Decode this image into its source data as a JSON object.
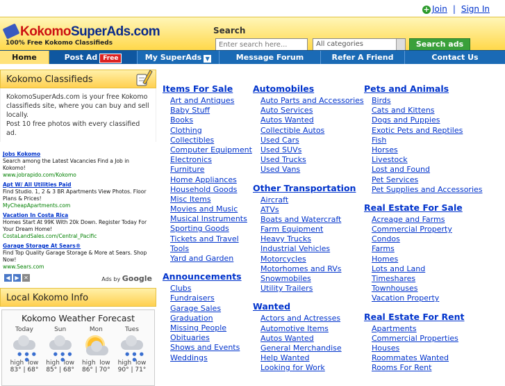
{
  "topbar": {
    "join": "Join",
    "sep": "|",
    "signin": "Sign In"
  },
  "header": {
    "logo_a": "Kokomo",
    "logo_b": "SuperAds",
    "logo_c": ".com",
    "tagline": "100% Free Kokomo Classifieds",
    "search_label": "Search",
    "search_placeholder": "Enter search here...",
    "category_value": "All categories",
    "search_button": "Search ads"
  },
  "nav": {
    "home": "Home",
    "post": "Post Ad",
    "free": "Free",
    "my": "My SuperAds",
    "forum": "Message Forum",
    "refer": "Refer A Friend",
    "contact": "Contact Us"
  },
  "left": {
    "classifieds_title": "Kokomo Classifieds",
    "about_1": "KokomoSuperAds.com is your free Kokomo classifieds site, where you can buy and sell locally.",
    "about_2": "Post 10 free photos with every classified ad.",
    "ads": [
      {
        "title": "Jobs Kokomo",
        "desc": "Search among the Latest Vacancies Find a Job in Kokomo!",
        "url": "www.jobrapido.com/Kokomo"
      },
      {
        "title": "Apt W/ All Utilities Paid",
        "desc": "Find Studio. 1, 2 & 3 BR Apartments View Photos. Floor Plans & Prices!",
        "url": "MyCheapApartments.com"
      },
      {
        "title": "Vacation In Costa Rica",
        "desc": "Homes Start At 99K With 20k Down. Register Today For Your Dream Home!",
        "url": "CostaLandSales.com/Central_Pacific"
      },
      {
        "title": "Garage Storage At Sears®",
        "desc": "Find Top Quality Garage Storage & More at Sears. Shop Now!",
        "url": "www.Sears.com"
      }
    ],
    "ads_by": "Ads by",
    "google": "Google",
    "local_title": "Local Kokomo Info",
    "weather_title": "Kokomo Weather Forecast",
    "days": [
      {
        "name": "Today",
        "icon": "rain-cloud-icon",
        "hi": "83°",
        "lo": "68°"
      },
      {
        "name": "Sun",
        "icon": "rain-cloud-icon",
        "hi": "85°",
        "lo": "68°"
      },
      {
        "name": "Mon",
        "icon": "partly-sunny-icon",
        "hi": "86°",
        "lo": "70°"
      },
      {
        "name": "Tues",
        "icon": "rain-cloud-icon",
        "hi": "90°",
        "lo": "71°"
      }
    ],
    "high": "high",
    "low": "low"
  },
  "categories": {
    "items": {
      "title": "Items For Sale",
      "links": [
        "Art and Antiques",
        "Baby Stuff",
        "Books",
        "Clothing",
        "Collectibles",
        "Computer Equipment",
        "Electronics",
        "Furniture",
        "Home Appliances",
        "Household Goods",
        "Misc Items",
        "Movies and Music",
        "Musical Instruments",
        "Sporting Goods",
        "Tickets and Travel",
        "Tools",
        "Yard and Garden"
      ]
    },
    "announcements": {
      "title": "Announcements",
      "links": [
        "Clubs",
        "Fundraisers",
        "Garage Sales",
        "Graduation",
        "Missing People",
        "Obituaries",
        "Shows and Events",
        "Weddings"
      ]
    },
    "automobiles": {
      "title": "Automobiles",
      "links": [
        "Auto Parts and Accessories",
        "Auto Services",
        "Autos Wanted",
        "Collectible Autos",
        "Used Cars",
        "Used SUVs",
        "Used Trucks",
        "Used Vans"
      ]
    },
    "transport": {
      "title": "Other Transportation",
      "links": [
        "Aircraft",
        "ATVs",
        "Boats and Watercraft",
        "Farm Equipment",
        "Heavy Trucks",
        "Industrial Vehicles",
        "Motorcycles",
        "Motorhomes and RVs",
        "Snowmobiles",
        "Utility Trailers"
      ]
    },
    "wanted": {
      "title": "Wanted",
      "links": [
        "Actors and Actresses",
        "Automotive Items",
        "Autos Wanted",
        "General Merchandise",
        "Help Wanted",
        "Looking for Work"
      ]
    },
    "pets": {
      "title": "Pets and Animals",
      "links": [
        "Birds",
        "Cats and Kittens",
        "Dogs and Puppies",
        "Exotic Pets and Reptiles",
        "Fish",
        "Horses",
        "Livestock",
        "Lost and Found",
        "Pet Services",
        "Pet Supplies and Accessories"
      ]
    },
    "realestate": {
      "title": "Real Estate For Sale",
      "links": [
        "Acreage and Farms",
        "Commercial Property",
        "Condos",
        "Farms",
        "Homes",
        "Lots and Land",
        "Timeshares",
        "Townhouses",
        "Vacation Property"
      ]
    },
    "rent": {
      "title": "Real Estate For Rent",
      "links": [
        "Apartments",
        "Commercial Properties",
        "Houses",
        "Roommates Wanted",
        "Rooms For Rent"
      ]
    }
  }
}
